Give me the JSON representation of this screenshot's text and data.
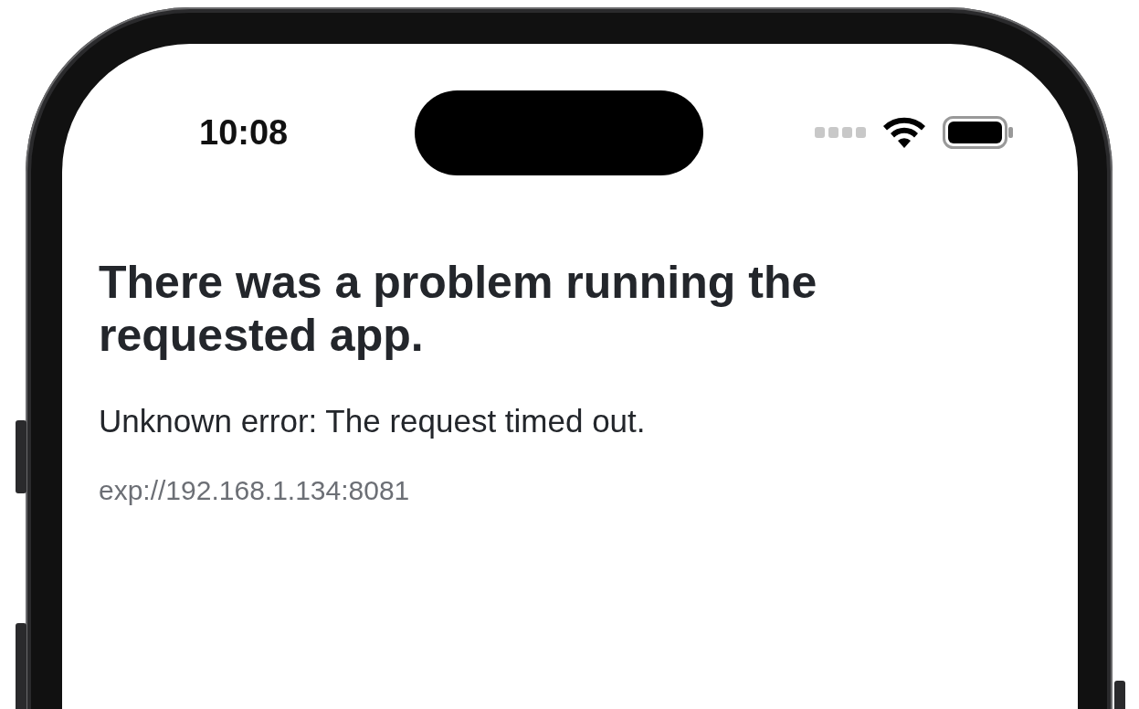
{
  "status_bar": {
    "time": "10:08"
  },
  "error": {
    "title": "There was a problem running the requested app.",
    "message": "Unknown error: The request timed out.",
    "url": "exp://192.168.1.134:8081"
  }
}
